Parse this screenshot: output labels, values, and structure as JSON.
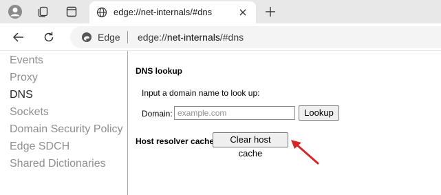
{
  "browser": {
    "tab_title": "edge://net-internals/#dns",
    "new_tab_symbol": "+",
    "address_site_label": "Edge",
    "url_scheme": "edge://",
    "url_host": "net-internals",
    "url_path": "/#dns",
    "icons": [
      "profile-icon",
      "workspaces-icon",
      "tab-actions-icon",
      "globe-icon",
      "close-icon",
      "new-tab-icon",
      "back-icon",
      "refresh-icon",
      "edge-logo-icon"
    ]
  },
  "sidebar": {
    "items": [
      {
        "label": "Events"
      },
      {
        "label": "Proxy"
      },
      {
        "label": "DNS",
        "active": true
      },
      {
        "label": "Sockets"
      },
      {
        "label": "Domain Security Policy"
      },
      {
        "label": "Edge SDCH"
      },
      {
        "label": "Shared Dictionaries"
      }
    ]
  },
  "dns": {
    "heading": "DNS lookup",
    "instructions": "Input a domain name to look up:",
    "domain_label": "Domain:",
    "domain_value": "",
    "domain_placeholder": "example.com",
    "lookup_button": "Lookup",
    "host_cache_label": "Host resolver cache",
    "clear_cache_button": "Clear host cache"
  },
  "annotation": {
    "arrow_color": "#d7262b"
  }
}
